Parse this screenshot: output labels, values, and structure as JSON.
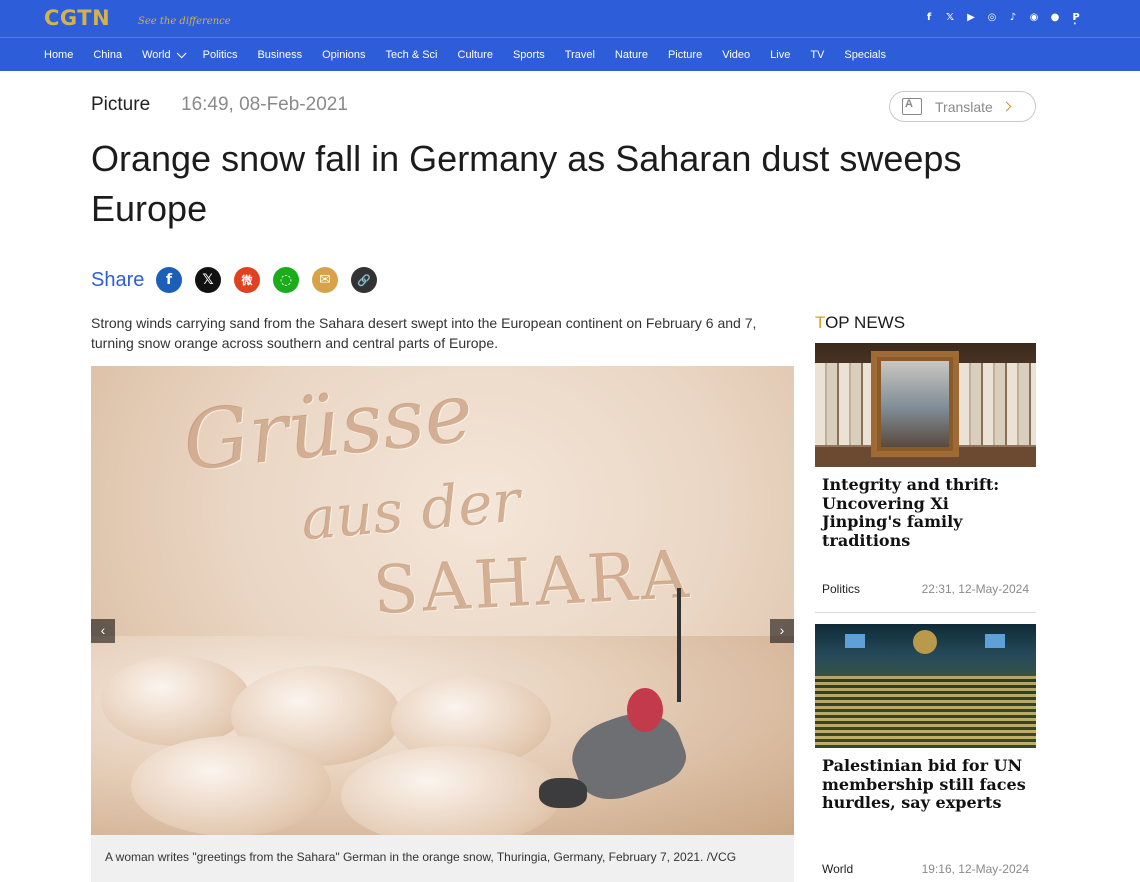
{
  "header": {
    "logo": "CGTN",
    "slogan": "See the difference",
    "social_icons": [
      {
        "name": "facebook-icon",
        "glyph": "f"
      },
      {
        "name": "x-icon",
        "glyph": "𝕏"
      },
      {
        "name": "youtube-icon",
        "glyph": "▶"
      },
      {
        "name": "instagram-icon",
        "glyph": "◎"
      },
      {
        "name": "tiktok-icon",
        "glyph": "♪"
      },
      {
        "name": "weibo-icon",
        "glyph": "◉"
      },
      {
        "name": "wechat-icon",
        "glyph": "●"
      },
      {
        "name": "pinterest-icon",
        "glyph": "P"
      }
    ],
    "more_glyph": "⋮",
    "brand_color": "#2d5dd8",
    "logo_color": "#d4b24a"
  },
  "nav": {
    "items": [
      "Home",
      "China",
      "World",
      "Politics",
      "Business",
      "Opinions",
      "Tech & Sci",
      "Culture",
      "Sports",
      "Travel",
      "Nature",
      "Picture",
      "Video",
      "Live",
      "TV",
      "Specials"
    ]
  },
  "article": {
    "section": "Picture",
    "date": "16:49, 08-Feb-2021",
    "translate_label": "Translate",
    "title": "Orange snow fall in Germany as Saharan dust sweeps Europe",
    "share_label": "Share",
    "lead": "Strong winds carrying sand from the Sahara desert swept into the European continent on February 6 and 7, turning snow orange across southern and central parts of Europe.",
    "photo": {
      "snow_text": [
        "Grüsse",
        "aus der",
        "SAHARA"
      ],
      "prev_glyph": "‹",
      "next_glyph": "›"
    },
    "caption": "A woman writes \"greetings from the Sahara\" German in the orange snow, Thuringia, Germany, February 7, 2021. /VCG"
  },
  "share_icons": [
    {
      "name": "facebook-share-icon",
      "glyph": "f"
    },
    {
      "name": "x-share-icon",
      "glyph": "𝕏"
    },
    {
      "name": "weibo-share-icon",
      "glyph": "微"
    },
    {
      "name": "wechat-share-icon",
      "glyph": "◌"
    },
    {
      "name": "email-share-icon",
      "glyph": "✉"
    },
    {
      "name": "copy-link-share-icon",
      "glyph": "🔗"
    }
  ],
  "sidebar": {
    "title_first": "T",
    "title_rest": "OP NEWS",
    "accent_color": "#d4a21e",
    "cards": [
      {
        "title": "Integrity and thrift: Uncovering Xi Jinping's family traditions",
        "category": "Politics",
        "time": "22:31, 12-May-2024"
      },
      {
        "title": "Palestinian bid for UN membership still faces hurdles, say experts",
        "category": "World",
        "time": "19:16, 12-May-2024"
      }
    ]
  }
}
